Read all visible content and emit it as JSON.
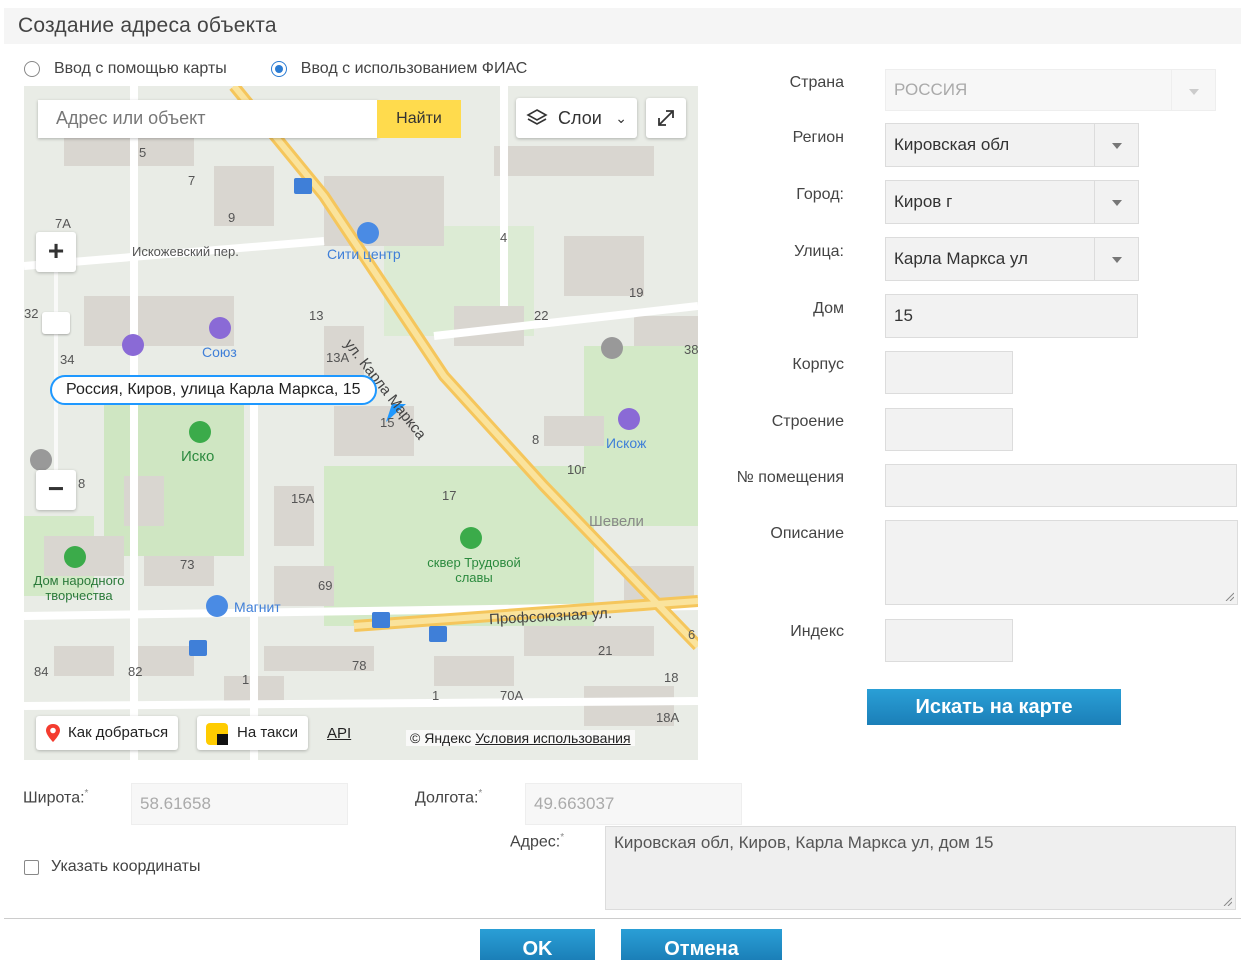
{
  "dialog": {
    "title": "Создание адреса объекта"
  },
  "mode": {
    "options": [
      {
        "label": "Ввод с помощью карты",
        "checked": false
      },
      {
        "label": "Ввод с использованием ФИАС",
        "checked": true
      }
    ]
  },
  "map": {
    "search_placeholder": "Адрес или объект",
    "find_label": "Найти",
    "layers_label": "Слои",
    "balloon_text": "Россия, Киров, улица Карла Маркса, 15",
    "route_label": "Как добраться",
    "taxi_label": "На такси",
    "api_label": "API",
    "copyright": "© Яндекс",
    "terms_label": "Условия использования",
    "labels": {
      "iskozhevsky": "Искожевский пер.",
      "city_center": "Сити центр",
      "karl_marx_street": "ул. Карла Маркса",
      "soyuz": "Союз",
      "isko": "Иско",
      "iskozh": "Искож",
      "sheveli": "Шевели",
      "square": "сквер Трудовой славы",
      "house_of_culture": "Дом народного творчества",
      "magnit": "Магнит",
      "profsoyuznaya": "Профсоюзная ул.",
      "n5": "5",
      "n7": "7",
      "n9": "9",
      "n7a": "7А",
      "n4": "4",
      "n19": "19",
      "n13": "13",
      "n13a": "13А",
      "n22": "22",
      "n38": "38",
      "n34": "34",
      "n32": "32",
      "n8a": "8",
      "n8b": "8",
      "n10g": "10г",
      "n15a": "15А",
      "n17": "17",
      "n73": "73",
      "n69": "69",
      "n84": "84",
      "n82": "82",
      "n78": "78",
      "n1a": "1",
      "n1b": "1",
      "n70a": "70А",
      "n21": "21",
      "n18": "18",
      "n18a": "18А",
      "n15": "15",
      "n6": "6"
    }
  },
  "form": {
    "country": {
      "label": "Страна",
      "value": "РОССИЯ"
    },
    "region": {
      "label": "Регион",
      "value": "Кировская обл"
    },
    "city": {
      "label": "Город:",
      "value": "Киров г"
    },
    "street": {
      "label": "Улица:",
      "value": "Карла Маркса ул"
    },
    "house": {
      "label": "Дом",
      "value": "15"
    },
    "building": {
      "label": "Корпус",
      "value": ""
    },
    "structure": {
      "label": "Строение",
      "value": ""
    },
    "room": {
      "label": "№ помещения",
      "value": ""
    },
    "description": {
      "label": "Описание",
      "value": ""
    },
    "index": {
      "label": "Индекс",
      "value": ""
    },
    "search_on_map": "Искать на карте"
  },
  "coords": {
    "lat_label": "Широта:",
    "lat_value": "58.61658",
    "lon_label": "Долгота:",
    "lon_value": "49.663037",
    "required_mark": "*",
    "specify_label": "Указать координаты",
    "specify_checked": false,
    "address_label": "Адрес:",
    "address_value": "Кировская обл, Киров, Карла Маркса ул, дом 15"
  },
  "footer": {
    "ok_label": "OK",
    "cancel_label": "Отмена"
  },
  "colors": {
    "accent": "#2b7cd3",
    "button": "#1b8ac6",
    "find": "#ffdb4d",
    "road": "#f7c85a",
    "park": "#c8e6b8"
  }
}
